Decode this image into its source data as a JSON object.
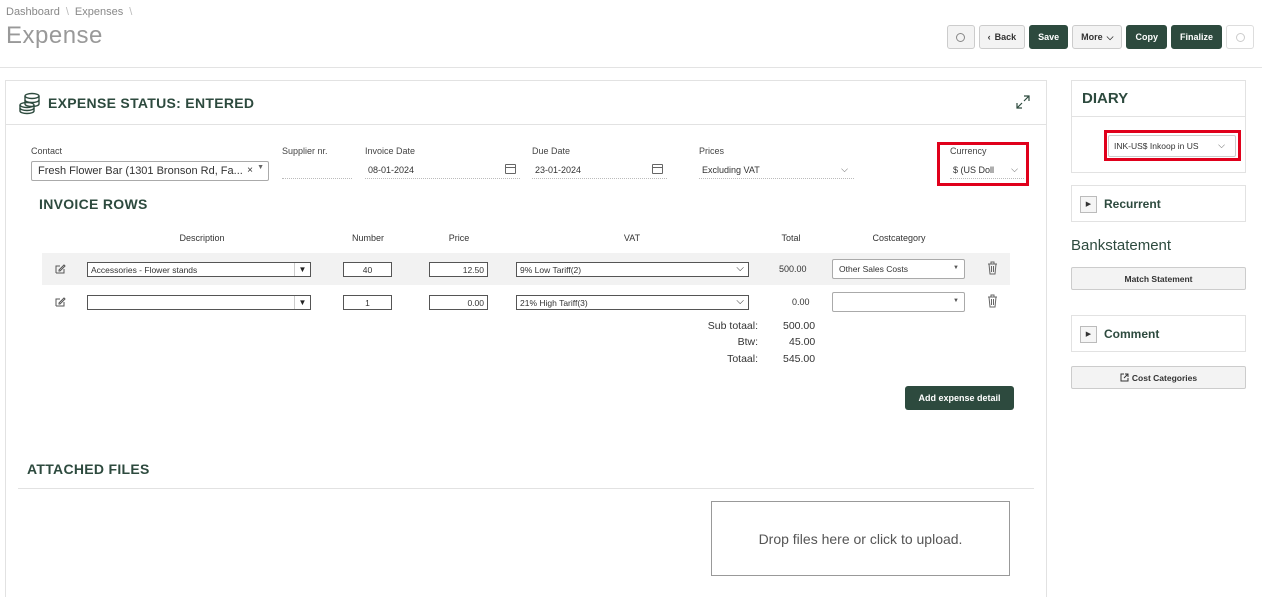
{
  "breadcrumb": [
    "Dashboard",
    "Expenses"
  ],
  "page_title": "Expense",
  "toolbar": {
    "back": "Back",
    "save": "Save",
    "more": "More",
    "copy": "Copy",
    "finalize": "Finalize"
  },
  "expense": {
    "status_title": "EXPENSE STATUS: ENTERED",
    "contact_label": "Contact",
    "contact_value": "Fresh Flower Bar (1301 Bronson Rd, Fa...",
    "supplier_label": "Supplier nr.",
    "supplier_value": "",
    "invoice_date_label": "Invoice Date",
    "invoice_date_value": "08-01-2024",
    "due_date_label": "Due Date",
    "due_date_value": "23-01-2024",
    "prices_label": "Prices",
    "prices_value": "Excluding VAT",
    "currency_label": "Currency",
    "currency_value": "$ (US Doll"
  },
  "invoice_rows": {
    "title": "INVOICE ROWS",
    "headers": {
      "description": "Description",
      "number": "Number",
      "price": "Price",
      "vat": "VAT",
      "total": "Total",
      "costcategory": "Costcategory"
    },
    "rows": [
      {
        "description": "Accessories - Flower stands",
        "number": "40",
        "price": "12.50",
        "vat": "9% Low Tariff(2)",
        "total": "500.00",
        "costcategory": "Other Sales Costs"
      },
      {
        "description": "",
        "number": "1",
        "price": "0.00",
        "vat": "21% High Tariff(3)",
        "total": "0.00",
        "costcategory": ""
      }
    ],
    "summary": {
      "subtotal_label": "Sub totaal:",
      "subtotal": "500.00",
      "btw_label": "Btw:",
      "btw": "45.00",
      "total_label": "Totaal:",
      "total": "545.00"
    },
    "add_button": "Add expense detail"
  },
  "attached": {
    "title": "ATTACHED FILES",
    "dropzone": "Drop files here or click to upload."
  },
  "sidebar": {
    "diary_title": "DIARY",
    "diary_value": "INK-US$ Inkoop in US",
    "recurrent": "Recurrent",
    "bankstatement_title": "Bankstatement",
    "match_statement": "Match Statement",
    "comment": "Comment",
    "cost_categories": "Cost Categories"
  },
  "colors": {
    "brand": "#2d4a3e",
    "highlight": "#e0001b"
  }
}
